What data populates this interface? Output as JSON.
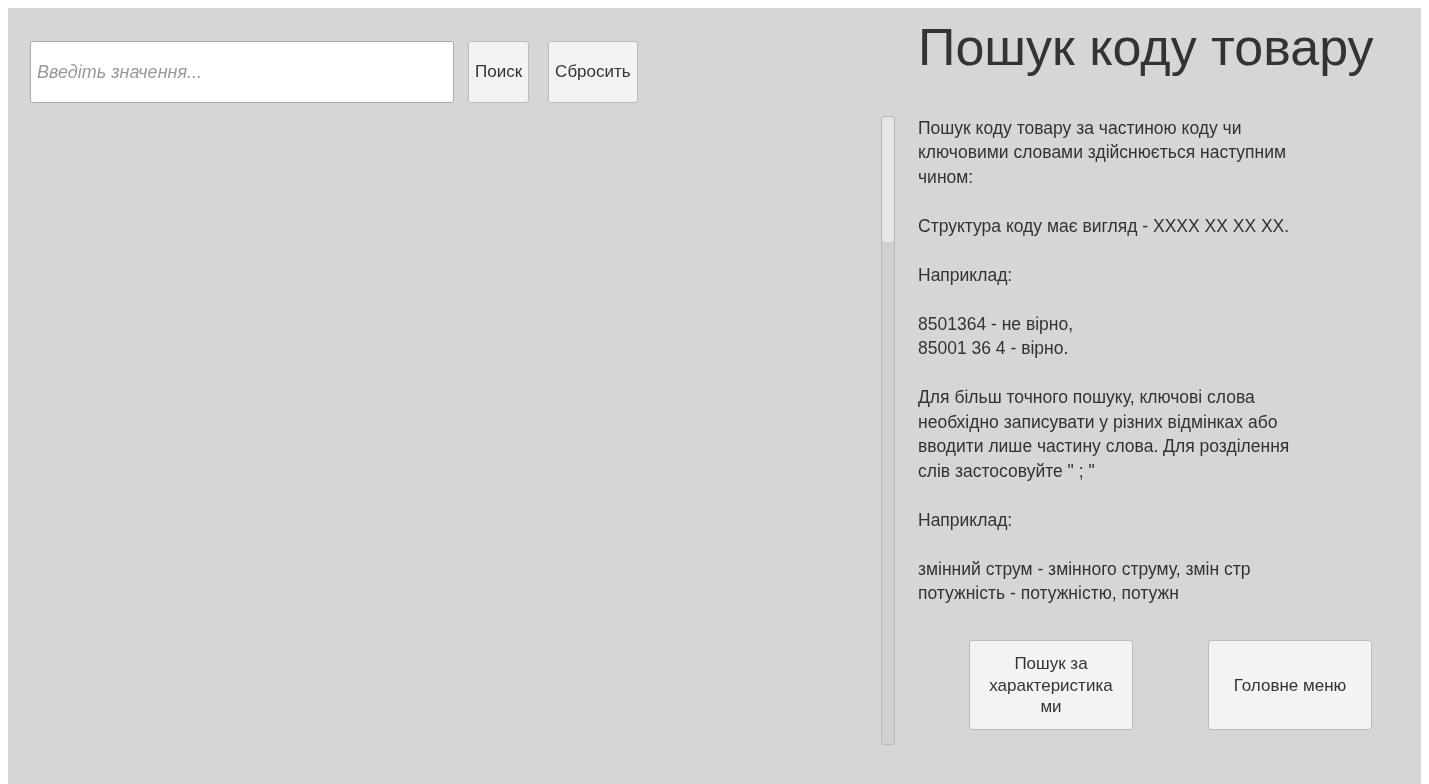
{
  "search": {
    "placeholder": "Введіть значення...",
    "buttons": [
      "Поиск",
      "Сбросить"
    ]
  },
  "help": {
    "title": "Пошук коду товару",
    "paragraphs": [
      "Пошук коду товару за частиною коду чи\nключовими словами здійснюється наступним\nчином:",
      "Структура коду має вигляд - XXXX XX XX XX.",
      "Наприклад:",
      "8501364 - не вірно,\n85001 36 4 - вірно.",
      "Для більш точного пошуку, ключові слова\nнеобхідно записувати у різних відмінках або\nвводити лише частину слова. Для розділення\nслів застосовуйте \" ; \"",
      "Наприклад:",
      "змінний струм - змінного струму, змін стр\nпотужність - потужністю, потужн"
    ],
    "buttons": [
      "Пошук за\nхарактеристика\nми",
      "Головне меню"
    ]
  }
}
